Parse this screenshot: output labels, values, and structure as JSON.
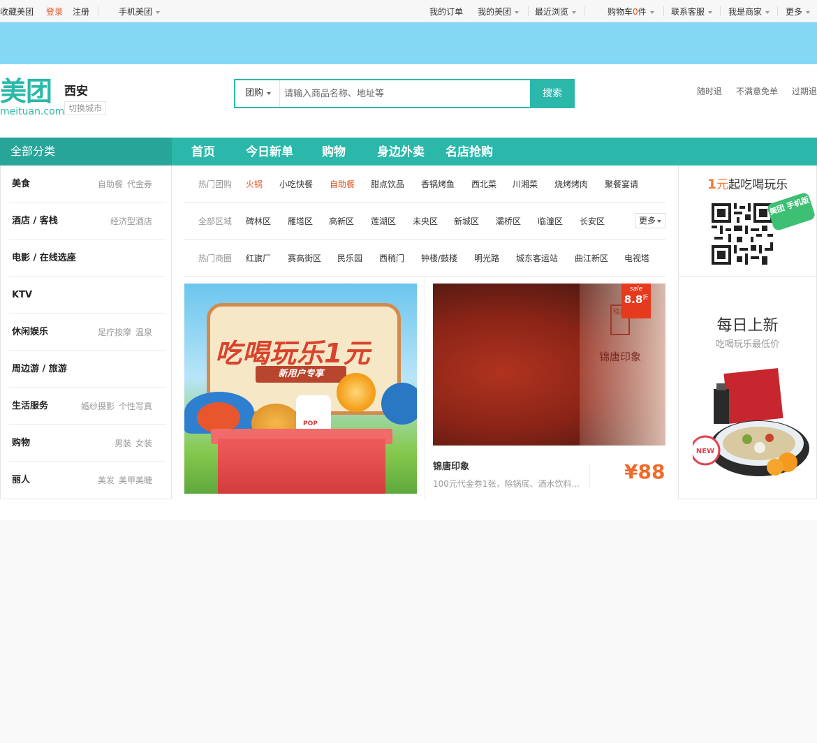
{
  "topbar": {
    "favorite": "收藏美团",
    "login": "登录",
    "register": "注册",
    "mobile": "手机美团",
    "my_orders": "我的订单",
    "my_meituan": "我的美团",
    "recent": "最近浏览",
    "cart_prefix": "购物车",
    "cart_count": "0",
    "cart_suffix": "件",
    "service": "联系客服",
    "merchant": "我是商家",
    "more": "更多"
  },
  "header": {
    "logo_cn": "美团",
    "logo_en": "meituan.com",
    "city": "西安",
    "switch_city": "切换城市",
    "search_type": "团购",
    "search_placeholder": "请输入商品名称、地址等",
    "search_button": "搜索",
    "guarantees": [
      "随时退",
      "不满意免单",
      "过期退"
    ]
  },
  "nav": {
    "all_categories": "全部分类",
    "items": [
      "首页",
      "今日新单",
      "购物",
      "身边外卖",
      "名店抢购"
    ]
  },
  "sidebar": {
    "categories": [
      {
        "name": "美食",
        "subs": [
          "自助餐",
          "代金券"
        ]
      },
      {
        "name": "酒店 / 客栈",
        "subs": [
          "经济型酒店"
        ]
      },
      {
        "name": "电影 / 在线选座",
        "subs": []
      },
      {
        "name": "KTV",
        "subs": []
      },
      {
        "name": "休闲娱乐",
        "subs": [
          "足疗按摩",
          "温泉"
        ]
      },
      {
        "name": "周边游 / 旅游",
        "subs": []
      },
      {
        "name": "生活服务",
        "subs": [
          "婚纱摄影",
          "个性写真"
        ]
      },
      {
        "name": "购物",
        "subs": [
          "男装",
          "女装"
        ]
      },
      {
        "name": "丽人",
        "subs": [
          "美发",
          "美甲美睫"
        ]
      }
    ]
  },
  "filters": {
    "hot_deals": {
      "label": "热门团购",
      "items": [
        "火锅",
        "小吃快餐",
        "自助餐",
        "甜点饮品",
        "香锅烤鱼",
        "西北菜",
        "川湘菜",
        "烧烤烤肉",
        "聚餐宴请"
      ]
    },
    "areas": {
      "label": "全部区域",
      "items": [
        "碑林区",
        "雁塔区",
        "高新区",
        "莲湖区",
        "未央区",
        "新城区",
        "灞桥区",
        "临潼区",
        "长安区"
      ],
      "more": "更多"
    },
    "hot_districts": {
      "label": "热门商圈",
      "items": [
        "红旗厂",
        "赛高街区",
        "民乐园",
        "西稍门",
        "钟楼/鼓楼",
        "明光路",
        "城东客运站",
        "曲江新区",
        "电视塔"
      ]
    }
  },
  "promo": {
    "title": "吃喝玩乐1元",
    "ribbon": "新用户专享",
    "box_text": "POP"
  },
  "deal": {
    "brand_mark": "锦唐",
    "brand_name": "锦唐印象",
    "sale_label": "sale",
    "sale_value": "8.8",
    "sale_unit": "折",
    "title": "锦唐印象",
    "desc": "100元代金券1张，除锅底、酒水饮料...",
    "price": "¥88"
  },
  "right": {
    "qr_one": "1",
    "qr_yuan": "元",
    "qr_rest": "起吃喝玩乐",
    "qr_tag": "美团 手机版",
    "daily_title": "每日上新",
    "daily_sub": "吃喝玩乐最低价",
    "new_badge": "NEW"
  },
  "colors": {
    "brand": "#2bb8aa",
    "accent": "#e5511d",
    "price": "#f06a2a",
    "banner": "#84d8f4"
  }
}
